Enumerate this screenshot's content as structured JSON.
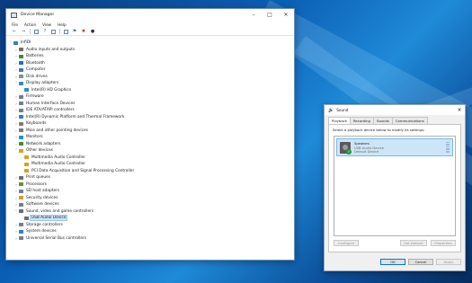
{
  "desktop": {
    "wallpaper": "windows-10-blue-light"
  },
  "device_manager": {
    "title": "Device Manager",
    "menu": [
      "File",
      "Action",
      "View",
      "Help"
    ],
    "toolbar_icons": [
      "back-arrow-icon",
      "forward-arrow-icon",
      "properties-icon",
      "help-icon",
      "scan-icon",
      "update-driver-icon",
      "disable-icon",
      "uninstall-icon",
      "download-icon"
    ],
    "root": "InfiDI",
    "tree": [
      {
        "label": "Audio inputs and outputs",
        "indent": 1,
        "caret": "›",
        "icon": "#6d6d6d"
      },
      {
        "label": "Batteries",
        "indent": 1,
        "caret": "›",
        "icon": "#3e8a3e"
      },
      {
        "label": "Bluetooth",
        "indent": 1,
        "caret": "›",
        "icon": "#1f6fc4"
      },
      {
        "label": "Computer",
        "indent": 1,
        "caret": "›",
        "icon": "#3b7bbd"
      },
      {
        "label": "Disk drives",
        "indent": 1,
        "caret": "›",
        "icon": "#8a8a8a"
      },
      {
        "label": "Display adapters",
        "indent": 1,
        "caret": "˅",
        "icon": "#2c8fb8"
      },
      {
        "label": "Intel(R) HD Graphics",
        "indent": 2,
        "caret": "",
        "icon": "#2c8fb8"
      },
      {
        "label": "Firmware",
        "indent": 1,
        "caret": "›",
        "icon": "#6f7f91"
      },
      {
        "label": "Human Interface Devices",
        "indent": 1,
        "caret": "›",
        "icon": "#6f7f91"
      },
      {
        "label": "IDE ATA/ATAPI controllers",
        "indent": 1,
        "caret": "›",
        "icon": "#6f7f91"
      },
      {
        "label": "Intel(R) Dynamic Platform and Thermal Framework",
        "indent": 1,
        "caret": "›",
        "icon": "#3b7bbd"
      },
      {
        "label": "Keyboards",
        "indent": 1,
        "caret": "›",
        "icon": "#7a7a7a"
      },
      {
        "label": "Mice and other pointing devices",
        "indent": 1,
        "caret": "›",
        "icon": "#7a7a7a"
      },
      {
        "label": "Monitors",
        "indent": 1,
        "caret": "›",
        "icon": "#2c8fb8"
      },
      {
        "label": "Network adapters",
        "indent": 1,
        "caret": "›",
        "icon": "#3e8a3e"
      },
      {
        "label": "Other devices",
        "indent": 1,
        "caret": "˅",
        "icon": "#d6a21e"
      },
      {
        "label": "Multimedia Audio Controller",
        "indent": 2,
        "caret": "",
        "icon": "#d6a21e"
      },
      {
        "label": "Multimedia Audio Controller",
        "indent": 2,
        "caret": "",
        "icon": "#d6a21e"
      },
      {
        "label": "PCI Data Acquisition and Signal Processing Controller",
        "indent": 2,
        "caret": "",
        "icon": "#d6a21e"
      },
      {
        "label": "Print queues",
        "indent": 1,
        "caret": "›",
        "icon": "#6d6d6d"
      },
      {
        "label": "Processors",
        "indent": 1,
        "caret": "›",
        "icon": "#6b8f3a"
      },
      {
        "label": "SD host adapters",
        "indent": 1,
        "caret": "›",
        "icon": "#6f7f91"
      },
      {
        "label": "Security devices",
        "indent": 1,
        "caret": "›",
        "icon": "#c8a22a"
      },
      {
        "label": "Software devices",
        "indent": 1,
        "caret": "›",
        "icon": "#6f7f91"
      },
      {
        "label": "Sound, video and game controllers",
        "indent": 1,
        "caret": "˅",
        "icon": "#6d6d6d"
      },
      {
        "label": "USB Audio Device",
        "indent": 2,
        "caret": "",
        "icon": "#6d6d6d",
        "selected": true
      },
      {
        "label": "Storage controllers",
        "indent": 1,
        "caret": "›",
        "icon": "#6f7f91"
      },
      {
        "label": "System devices",
        "indent": 1,
        "caret": "›",
        "icon": "#3b7bbd"
      },
      {
        "label": "Universal Serial Bus controllers",
        "indent": 1,
        "caret": "›",
        "icon": "#6f7f91"
      }
    ]
  },
  "sound": {
    "title": "Sound",
    "tabs": [
      "Playback",
      "Recording",
      "Sounds",
      "Communications"
    ],
    "active_tab": "Playback",
    "instruction": "Select a playback device below to modify its settings:",
    "device": {
      "name": "Speakers",
      "line2": "USB Audio Device",
      "line3": "Default Device"
    },
    "buttons": {
      "configure": "Configure",
      "set_default": "Set Default",
      "properties": "Properties",
      "ok": "OK",
      "cancel": "Cancel",
      "apply": "Apply"
    }
  }
}
